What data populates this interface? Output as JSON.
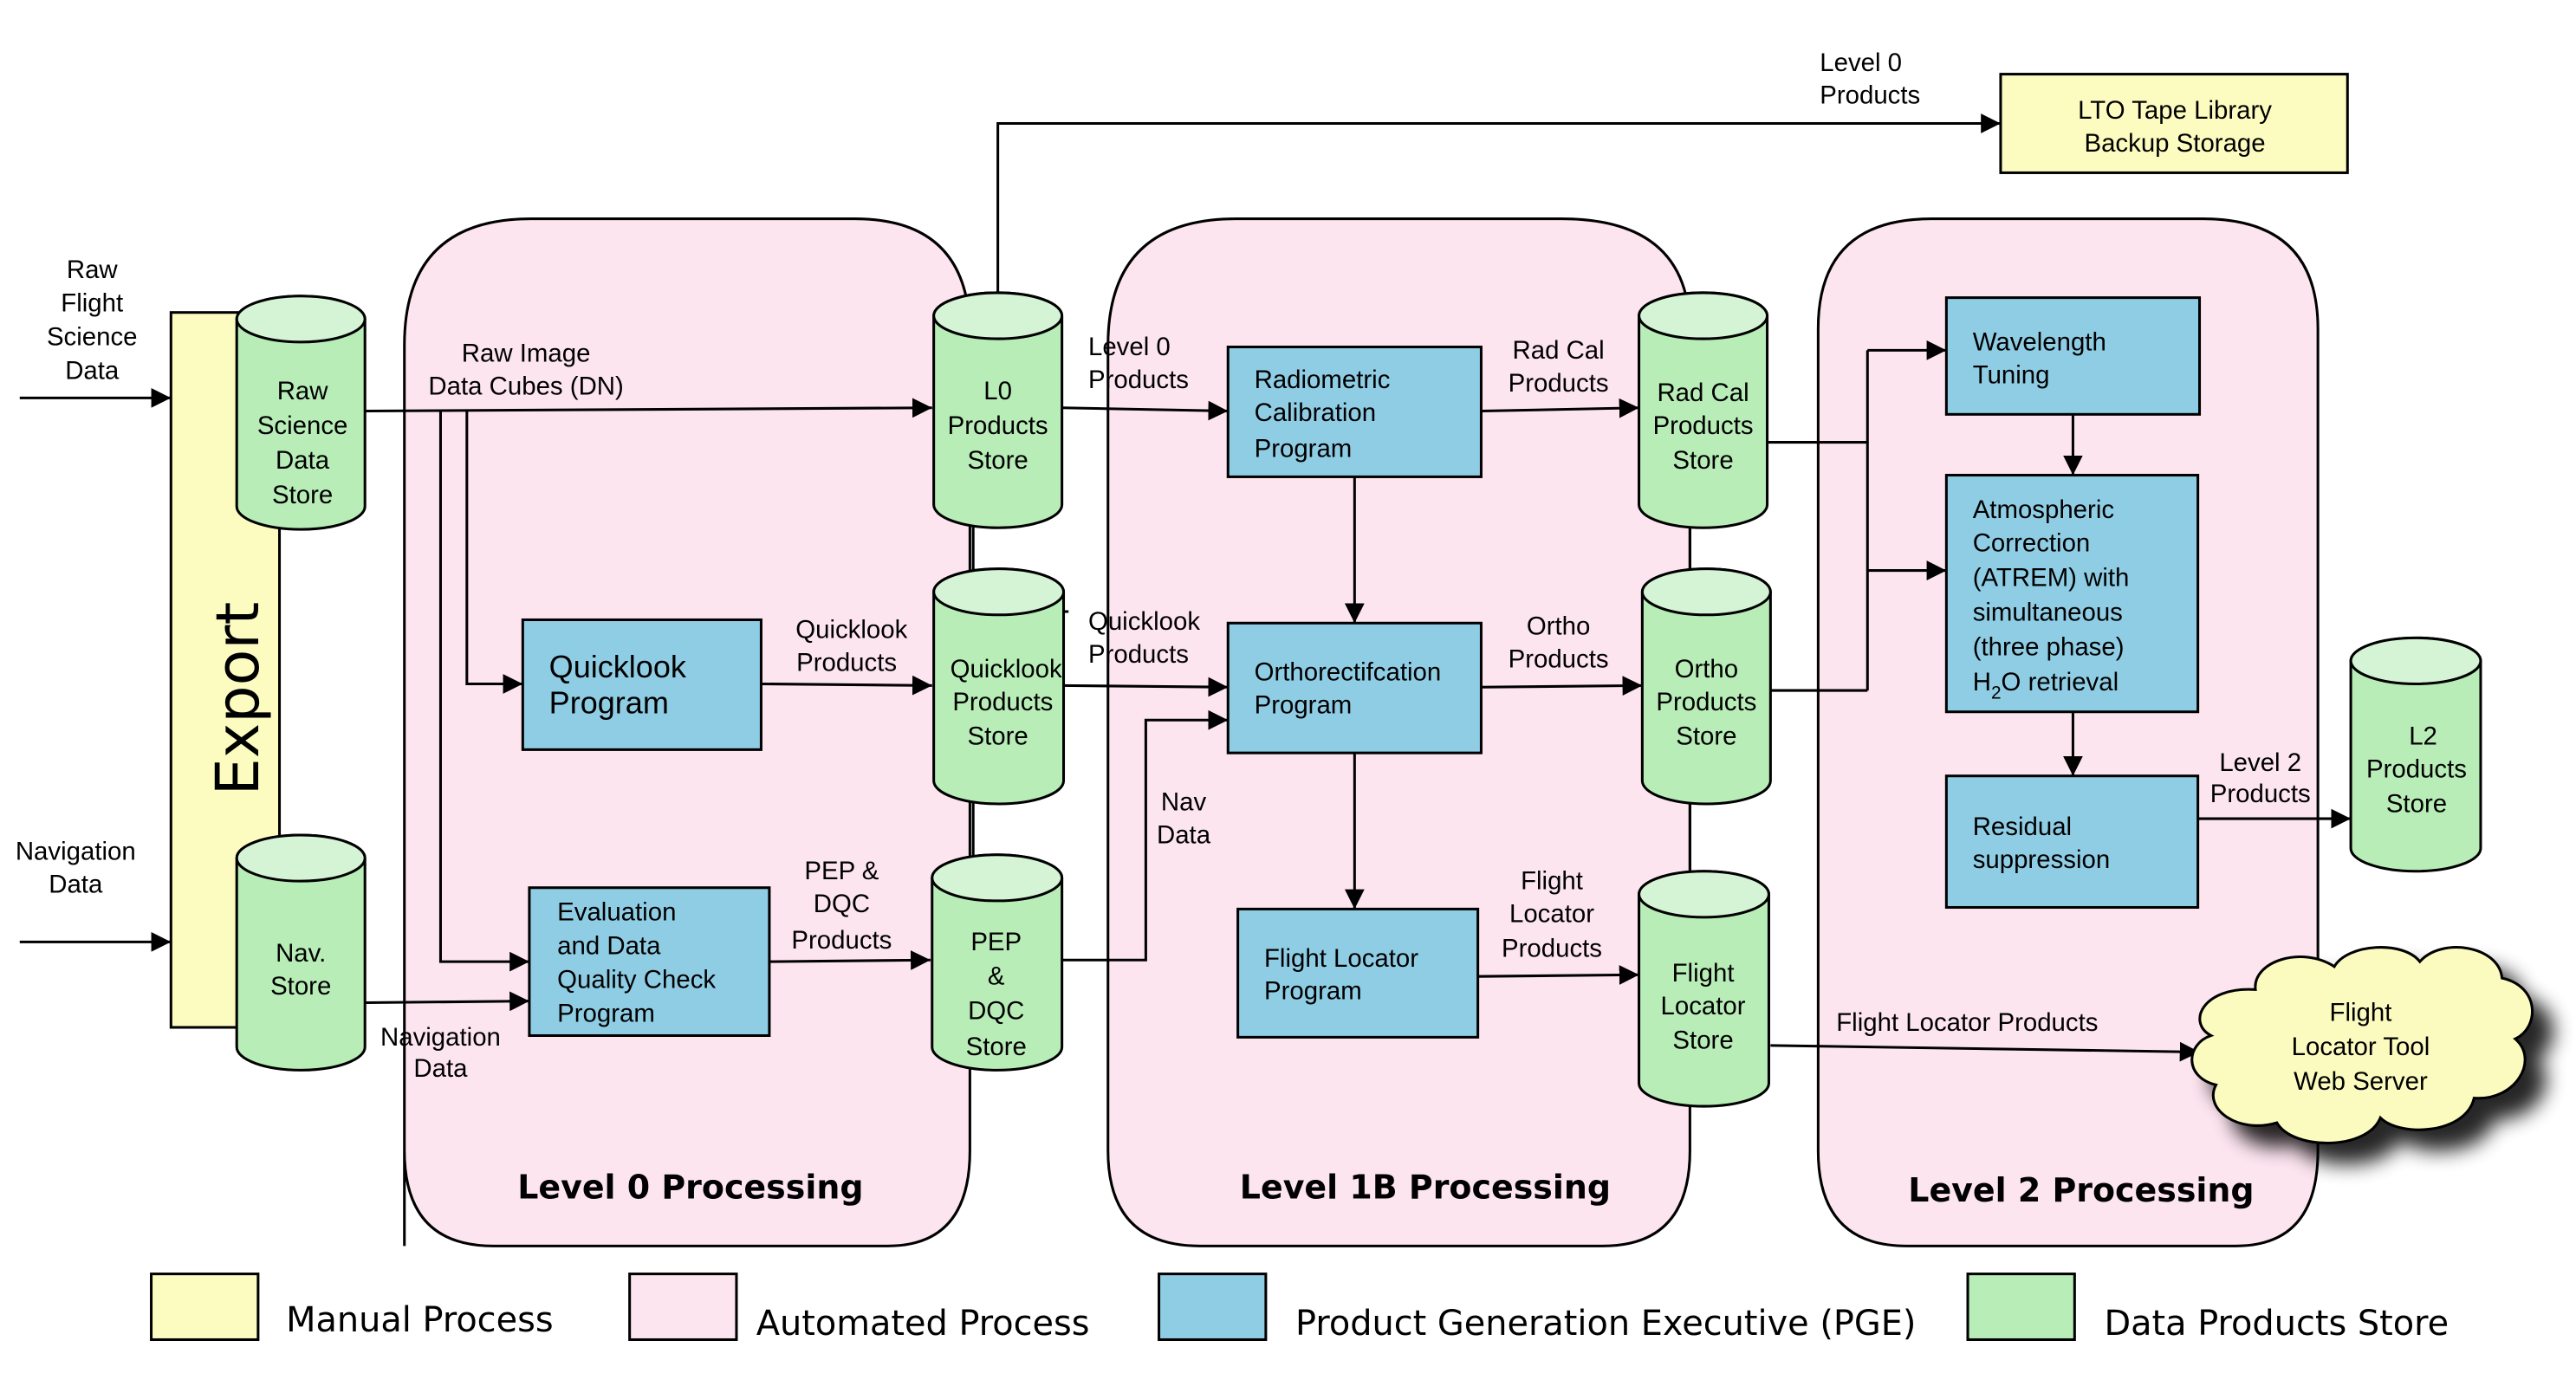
{
  "colors": {
    "manual": "#FCFCC0",
    "automated": "#FDE5F0",
    "pge": "#8FCDE5",
    "store": "#B8EDB8",
    "store_top": "#D5F3D5",
    "cloud": "#FBFBC0"
  },
  "inputs": {
    "raw_flight": [
      "Raw",
      "Flight",
      "Science",
      "Data"
    ],
    "navigation": [
      "Navigation",
      "Data"
    ]
  },
  "export_label": "Export",
  "stores": {
    "raw_science": [
      "Raw",
      "Science",
      "Data",
      "Store"
    ],
    "nav": [
      "Nav.",
      "Store"
    ],
    "l0": [
      "L0",
      "Products",
      "Store"
    ],
    "quicklook": [
      "Quicklook",
      "Products",
      "Store"
    ],
    "pep": [
      "PEP",
      "&",
      "DQC",
      "Store"
    ],
    "radcal": [
      "Rad Cal",
      "Products",
      "Store"
    ],
    "ortho": [
      "Ortho",
      "Products",
      "Store"
    ],
    "flight_locator": [
      "Flight",
      "Locator",
      "Store"
    ],
    "l2": [
      "L2",
      "Products",
      "Store"
    ]
  },
  "programs": {
    "quicklook": [
      "Quicklook",
      "Program"
    ],
    "evaluation": [
      "Evaluation",
      "and Data",
      "Quality Check",
      "Program"
    ],
    "radiometric": [
      "Radiometric",
      "Calibration",
      "Program"
    ],
    "ortho": [
      "Orthorectifcation",
      "Program"
    ],
    "flight_locator": [
      "Flight Locator",
      "Program"
    ],
    "wavelength": [
      "Wavelength",
      "Tuning"
    ],
    "atmospheric": [
      "Atmospheric",
      "Correction",
      "(ATREM) with",
      "simultaneous",
      "(three phase)"
    ],
    "atmospheric_last": {
      "h": "H",
      "sub": "2",
      "rest": "O retrieval"
    },
    "residual": [
      "Residual",
      "suppression"
    ]
  },
  "flow_labels": {
    "raw_image": [
      "Raw Image",
      "Data Cubes (DN)"
    ],
    "quicklook_products": [
      "Quicklook",
      "Products"
    ],
    "pep_dqc": [
      "PEP &",
      "DQC",
      "Products"
    ],
    "navigation_data": [
      "Navigation",
      "Data"
    ],
    "level0_products": [
      "Level 0",
      "Products"
    ],
    "level0_products_top": [
      "Level 0",
      "Products"
    ],
    "quicklook_products_2": [
      "Quicklook",
      "Products"
    ],
    "nav_data": [
      "Nav",
      "Data"
    ],
    "radcal_products": [
      "Rad Cal",
      "Products"
    ],
    "ortho_products": [
      "Ortho",
      "Products"
    ],
    "flight_locator_products": [
      "Flight",
      "Locator",
      "Products"
    ],
    "level2_products": [
      "Level 2",
      "Products"
    ],
    "flight_locator_products_long": "Flight Locator Products"
  },
  "backup": [
    "LTO Tape Library",
    "Backup Storage"
  ],
  "cloud": [
    "Flight",
    "Locator Tool",
    "Web Server"
  ],
  "regions": {
    "level0": "Level 0 Processing",
    "level1b": "Level 1B Processing",
    "level2": "Level 2 Processing"
  },
  "legend": [
    {
      "label": "Manual Process"
    },
    {
      "label": "Automated Process"
    },
    {
      "label": "Product Generation Executive (PGE)"
    },
    {
      "label": "Data Products Store"
    }
  ]
}
